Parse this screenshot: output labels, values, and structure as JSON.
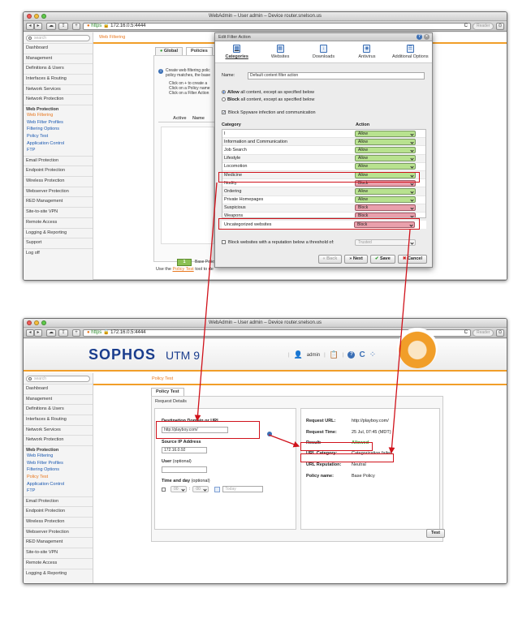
{
  "colors": {
    "accent": "#e8761c",
    "brand": "#1a3d8d",
    "highlight": "#d0121b",
    "allow": "#b8e28f",
    "block": "#e9a0ac",
    "link": "#1a58b0"
  },
  "top_window": {
    "title": "WebAdmin – User admin – Device router.snelson.us",
    "toolbar": {
      "back": "◂",
      "forward": "▸",
      "cloud_icon": "cloud-icon",
      "share_icon": "share-icon",
      "add": "+",
      "https": "https",
      "url": "172.16.0.5:4444",
      "reload": "C",
      "reader": "Reader"
    },
    "sidebar": {
      "search_placeholder": "search",
      "items_top": [
        "Dashboard",
        "Management",
        "Definitions & Users",
        "Interfaces & Routing",
        "Network Services",
        "Network Protection"
      ],
      "group": "Web Protection",
      "sub_items": [
        "Web Filtering",
        "Web Filter Profiles",
        "Filtering Options",
        "Policy Test",
        "Application Control",
        "FTP"
      ],
      "items_bottom": [
        "Email Protection",
        "Endpoint Protection",
        "Wireless Protection",
        "Webserver Protection",
        "RED Management",
        "Site-to-site VPN",
        "Remote Access",
        "Logging & Reporting",
        "Support",
        "Log off"
      ]
    },
    "main": {
      "breadcrumb": "Web Filtering",
      "tabs": [
        "Global",
        "Policies"
      ],
      "info_lines": [
        "Create web filtering polic",
        "policy matches, the base",
        "Click on + to create a",
        "Click on a Policy name",
        "Click on a Filter Action"
      ],
      "col_active": "Active",
      "col_name": "Name",
      "base_policy_num": "1",
      "base_policy": "Base Policy",
      "footer_text_1": "Use the",
      "footer_link": "Policy Test",
      "footer_text_2": "tool to de"
    },
    "dialog": {
      "title": "Edit Filter Action",
      "tabs": [
        {
          "label": "Categories",
          "icon": "categories-icon",
          "glyph": "▤"
        },
        {
          "label": "Websites",
          "icon": "websites-icon",
          "glyph": "▦"
        },
        {
          "label": "Downloads",
          "icon": "downloads-icon",
          "glyph": "↓"
        },
        {
          "label": "Antivirus",
          "icon": "antivirus-icon",
          "glyph": "◉"
        },
        {
          "label": "Additional Options",
          "icon": "options-icon",
          "glyph": "☰"
        }
      ],
      "name_label": "Name:",
      "name_value": "Default content filter action",
      "allow_bold": "Allow",
      "allow_rest": " all content, except as specified below",
      "block_bold": "Block",
      "block_rest": " all content, except as specified below",
      "spyware": "Block Spyware infection and communication",
      "col_category": "Category",
      "col_action": "Action",
      "categories": [
        {
          "name": "I",
          "action": "Allow"
        },
        {
          "name": "Information and Communication",
          "action": "Allow"
        },
        {
          "name": "Job Search",
          "action": "Allow"
        },
        {
          "name": "Lifestyle",
          "action": "Allow"
        },
        {
          "name": "Locomotion",
          "action": "Allow"
        },
        {
          "name": "Medicine",
          "action": "Allow"
        },
        {
          "name": "Nudity",
          "action": "Block"
        },
        {
          "name": "Ordering",
          "action": "Allow"
        },
        {
          "name": "Private Homepages",
          "action": "Allow"
        },
        {
          "name": "Suspicious",
          "action": "Block"
        },
        {
          "name": "Weapons",
          "action": "Block"
        }
      ],
      "uncategorized": "Uncategorized websites",
      "uncategorized_action": "Block",
      "reputation": "Block websites with a reputation below a threshold of:",
      "reputation_value": "Trusted",
      "btn_back": "Back",
      "btn_next": "Next",
      "btn_save": "Save",
      "btn_cancel": "Cancel"
    }
  },
  "bottom_window": {
    "title": "WebAdmin – User admin – Device router.snelson.us",
    "toolbar": {
      "https": "https",
      "url": "172.16.0.5:4444",
      "reader": "Reader"
    },
    "header": {
      "logo": "SOPHOS",
      "product": "UTM 9",
      "user": "admin"
    },
    "sidebar": {
      "search_placeholder": "search",
      "items_top": [
        "Dashboard",
        "Management",
        "Definitions & Users",
        "Interfaces & Routing",
        "Network Services",
        "Network Protection"
      ],
      "group": "Web Protection",
      "sub_items": [
        "Web Filtering",
        "Web Filter Profiles",
        "Filtering Options",
        "Policy Test",
        "Application Control",
        "FTP"
      ],
      "items_bottom": [
        "Email Protection",
        "Endpoint Protection",
        "Wireless Protection",
        "Webserver Protection",
        "RED Management",
        "Site-to-site VPN",
        "Remote Access",
        "Logging & Reporting"
      ]
    },
    "main": {
      "breadcrumb": "Policy Test",
      "tab": "Policy Test",
      "section": "Request Details",
      "dest_label": "Destination Domain or URL",
      "dest_value": "http://playboy.com/",
      "src_label": "Source IP Address",
      "src_value": "172.16.0.92",
      "user_label": "User",
      "user_opt": " (optional)",
      "time_label": "Time and day",
      "time_opt": " (optional)",
      "hour": "00",
      "minute": "00",
      "date_placeholder": "Today",
      "req_url_label": "Request URL:",
      "req_url": "http://playboy.com/",
      "req_time_label": "Request Time:",
      "req_time": "25 Jul, 07:45 (MDT)",
      "result_label": "Result:",
      "result": "Allowed",
      "cat_label": "URL Category:",
      "cat": "Categorization failed",
      "rep_label": "URL Reputation:",
      "rep": "Neutral",
      "policy_label": "Policy name:",
      "policy": "Base Policy",
      "test_btn": "Test"
    }
  }
}
